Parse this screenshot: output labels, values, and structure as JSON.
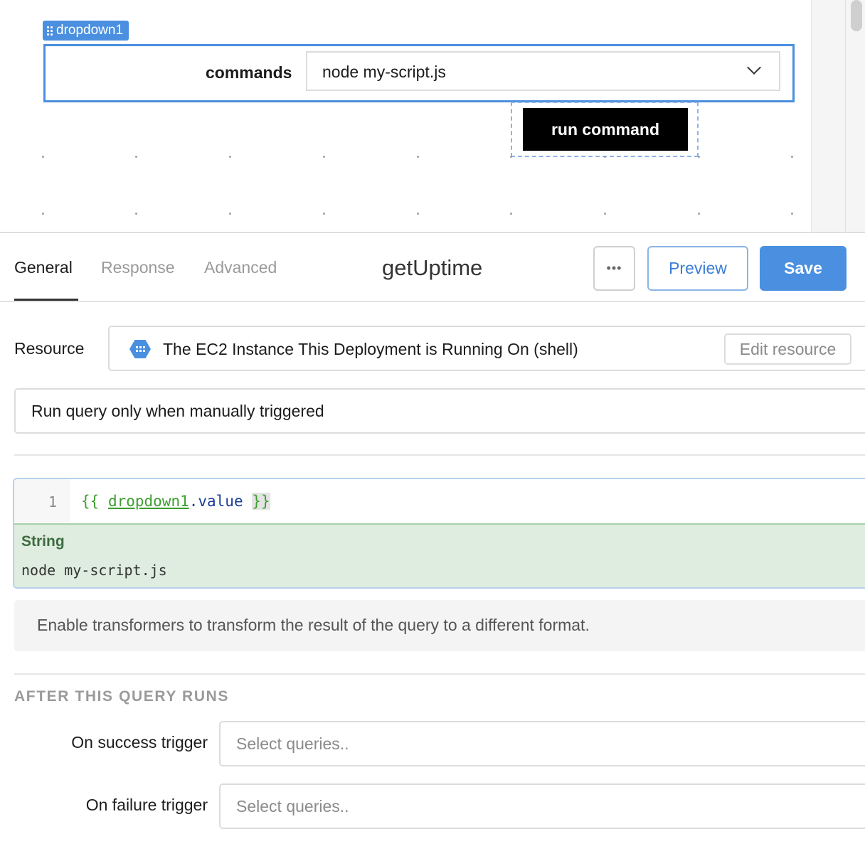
{
  "canvas": {
    "component_tag": "dropdown1",
    "dropdown_label": "commands",
    "dropdown_value": "node my-script.js",
    "button_label": "run command"
  },
  "editor": {
    "tabs": [
      {
        "label": "General",
        "active": true
      },
      {
        "label": "Response",
        "active": false
      },
      {
        "label": "Advanced",
        "active": false
      }
    ],
    "query_name": "getUptime",
    "more_label": "•••",
    "preview_label": "Preview",
    "save_label": "Save",
    "resource": {
      "label": "Resource",
      "name": "The EC2 Instance This Deployment is Running On (shell)",
      "edit_label": "Edit resource"
    },
    "trigger_mode": "Run query only when manually triggered",
    "code": {
      "line_number": "1",
      "open_brace": "{{ ",
      "ref": "dropdown1",
      "prop": ".value",
      "space": " ",
      "close_brace": "}}"
    },
    "result": {
      "type": "String",
      "value": "node my-script.js"
    },
    "transformer_text": "Enable transformers to transform the result of the query to a different format.",
    "after_section": "AFTER THIS QUERY RUNS",
    "on_success": {
      "label": "On success trigger",
      "placeholder": "Select queries.."
    },
    "on_failure": {
      "label": "On failure trigger",
      "placeholder": "Select queries.."
    }
  },
  "colors": {
    "accent": "#4a8fe0",
    "button_dark": "#000000",
    "result_bg": "#deeddf",
    "code_green": "#3c9e2e"
  }
}
